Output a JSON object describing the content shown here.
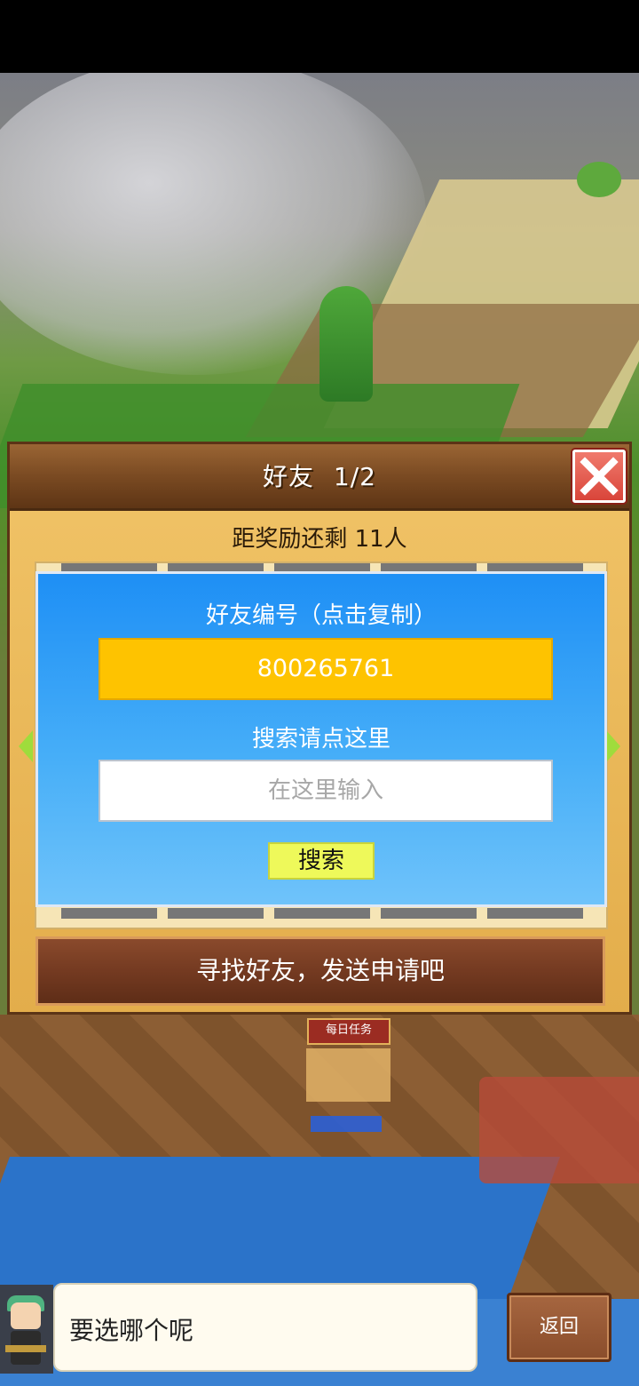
{
  "dialog": {
    "title": "好友",
    "page": "1/2",
    "reward_text": "距奖励还剩 11人",
    "friend_id_label": "好友编号（点击复制）",
    "friend_id": "800265761",
    "search_label": "搜索请点这里",
    "search_placeholder": "在这里输入",
    "search_button": "搜索",
    "send_request_button": "寻找好友，发送申请吧"
  },
  "map": {
    "quest_badge": "每日任务"
  },
  "bottom": {
    "speech_text": "要选哪个呢",
    "back_button": "返回"
  },
  "icons": {
    "close": "close-icon",
    "left_arrow": "left-arrow-icon",
    "right_arrow": "right-arrow-icon"
  },
  "colors": {
    "id_box": "#fec300",
    "panel_blue": "#1e8ff5",
    "search_button": "#eef95a",
    "close_button": "#d9453a"
  }
}
